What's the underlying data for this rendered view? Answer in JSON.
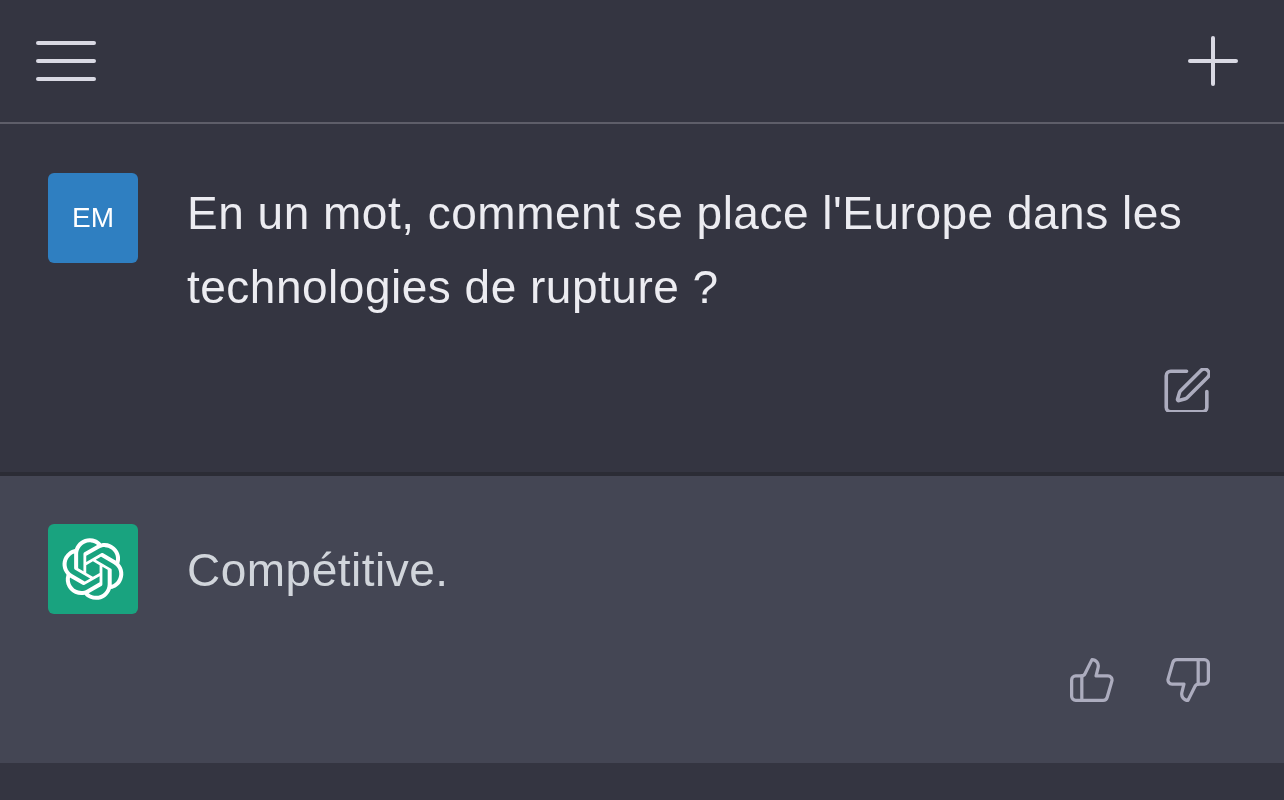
{
  "messages": [
    {
      "kind": "user",
      "avatar": "EM",
      "text": "En un mot, comment se place l'Europe dans les technologies de rupture ?"
    },
    {
      "kind": "assistant",
      "text": "Compétitive."
    }
  ]
}
